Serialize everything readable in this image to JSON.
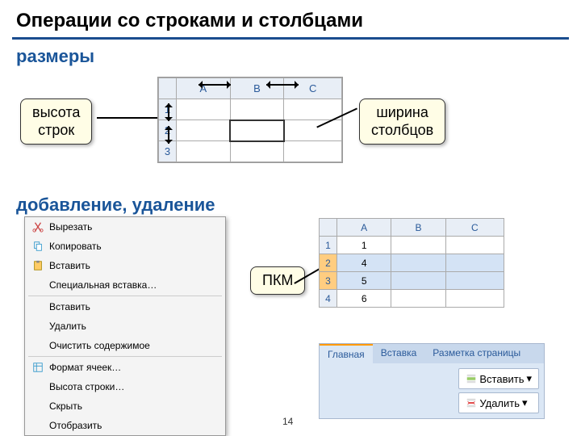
{
  "title": "Операции со строками и столбцами",
  "sec_sizes": "размеры",
  "sec_add": "добавление, удаление",
  "callout_rows": "высота\nстрок",
  "callout_cols": "ширина\nстолбцов",
  "pkm": "ПКМ",
  "ribbon": {
    "tab1": "Главная",
    "tab2": "Вставка",
    "tab3": "Разметка страницы",
    "btn_ins": "Вставить",
    "btn_del": "Удалить"
  },
  "ctx": {
    "cut": "Вырезать",
    "copy": "Копировать",
    "paste": "Вставить",
    "pspecial": "Специальная вставка…",
    "insert": "Вставить",
    "delete": "Удалить",
    "clear": "Очистить содержимое",
    "fmt": "Формат ячеек…",
    "rowh": "Высота строки…",
    "hide": "Скрыть",
    "show": "Отобразить"
  },
  "grid2_data": {
    "a": [
      1,
      4,
      5,
      6
    ]
  },
  "page": "14"
}
